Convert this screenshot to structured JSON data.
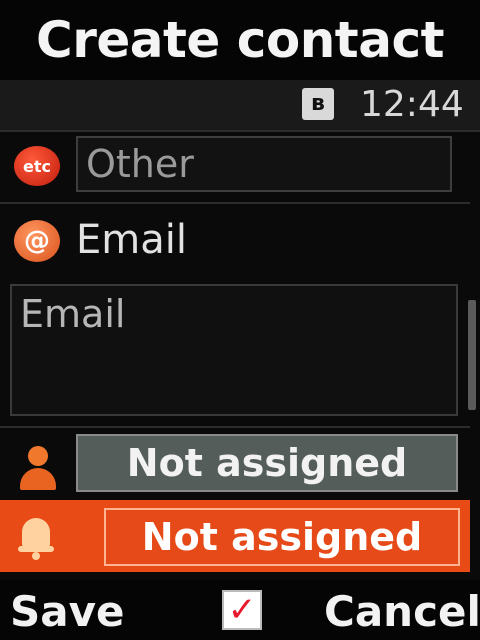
{
  "header": {
    "title": "Create contact"
  },
  "status_bar": {
    "bluetooth_icon": "bluetooth-icon",
    "bluetooth_glyph": "ʙ",
    "time": "12:44"
  },
  "form": {
    "other": {
      "icon": "etc-icon",
      "icon_text": "etc",
      "value": "Other"
    },
    "email": {
      "icon": "at-sign-icon",
      "icon_text": "@",
      "label": "Email",
      "placeholder": "Email"
    },
    "caller_group": {
      "icon": "person-icon",
      "value": "Not assigned"
    },
    "ringtone": {
      "icon": "bell-icon",
      "value": "Not assigned",
      "selected": true
    }
  },
  "softkeys": {
    "left_label": "Save",
    "center_icon": "checkbox-checked-icon",
    "center_glyph": "✓",
    "right_label": "Cancel"
  },
  "colors": {
    "accent": "#e84b16",
    "selected_field": "#e54a18",
    "unselected_field": "#555d5a",
    "background": "#0a0a0a"
  }
}
